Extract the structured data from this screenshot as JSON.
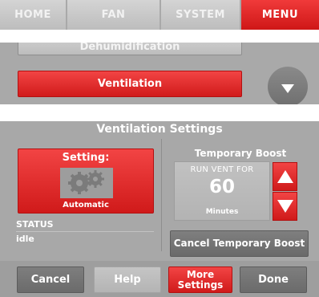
{
  "tabs": [
    {
      "label": "HOME",
      "active": false
    },
    {
      "label": "FAN",
      "active": false
    },
    {
      "label": "SYSTEM",
      "active": false
    },
    {
      "label": "MENU",
      "active": true
    }
  ],
  "menu_list": {
    "prev_item": "Dehumidification",
    "active_item": "Ventilation",
    "scroll_icon": "chevron-down-icon"
  },
  "ventilation": {
    "title": "Ventilation Settings",
    "setting_label": "Setting:",
    "setting_icon": "gears-icon",
    "setting_value": "Automatic",
    "status_label": "STATUS",
    "status_value": "idle",
    "boost_title": "Temporary Boost",
    "boost_caption": "RUN VENT FOR",
    "boost_value": "60",
    "boost_unit": "Minutes",
    "cancel_boost_label": "Cancel Temporary Boost"
  },
  "footer": {
    "cancel_label": "Cancel",
    "help_label": "Help",
    "more_settings_label": "More Settings",
    "done_label": "Done"
  },
  "colors": {
    "accent_red": "#e02a2a",
    "panel_gray": "#a8a8a8",
    "dark_button": "#747474"
  }
}
